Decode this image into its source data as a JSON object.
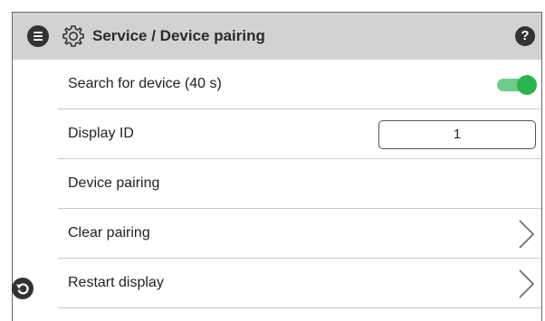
{
  "header": {
    "title": "Service / Device pairing",
    "help_symbol": "?",
    "icons": [
      "menu-icon",
      "gear-icon",
      "help-icon"
    ],
    "background": "#d2d2d2"
  },
  "rows": [
    {
      "label": "Search for device (40 s)",
      "control": "toggle",
      "toggle_on": true
    },
    {
      "label": "Display ID",
      "control": "input",
      "value": "1"
    },
    {
      "label": "Device pairing",
      "control": "none"
    },
    {
      "label": "Clear pairing",
      "control": "chevron"
    },
    {
      "label": "Restart display",
      "control": "chevron"
    }
  ],
  "footer": {
    "icons": [
      "back-icon"
    ]
  },
  "colors": {
    "toggle_knob": "#2cb44c",
    "toggle_track": "#6ecb8a",
    "icon_dark": "#333333"
  }
}
